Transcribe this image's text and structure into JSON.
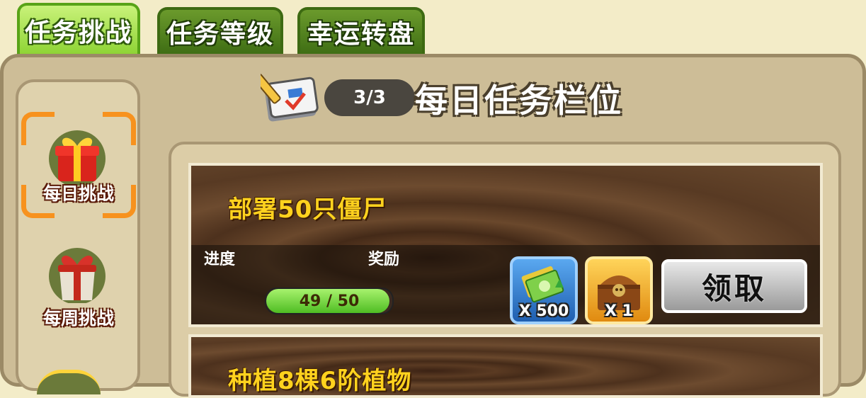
{
  "tabs": [
    {
      "label": "任务挑战",
      "active": true
    },
    {
      "label": "任务等级",
      "active": false
    },
    {
      "label": "幸运转盘",
      "active": false
    }
  ],
  "sidebar": {
    "items": [
      {
        "label": "每日挑战",
        "icon": "gift-box-icon",
        "selected": true
      },
      {
        "label": "每周挑战",
        "icon": "gift-bag-icon",
        "selected": false
      }
    ]
  },
  "header": {
    "icon": "notebook-pencil-icon",
    "counter": "3/3",
    "title": "每日任务栏位"
  },
  "tasks": [
    {
      "title": "部署50只僵尸",
      "progress_label": "进度",
      "reward_label": "奖励",
      "progress_text": "49 / 50",
      "progress_fraction": 0.98,
      "rewards": [
        {
          "icon": "cash-bills-icon",
          "qty": "X 500",
          "frame_color": "#2f7fd1"
        },
        {
          "icon": "treasure-chest-icon",
          "qty": "X 1",
          "frame_color": "#f0a020"
        }
      ],
      "claim_label": "领取"
    },
    {
      "title": "种植8棵6阶植物"
    }
  ],
  "colors": {
    "tab_active": "#8dd334",
    "tab_inactive": "#3f6e14",
    "task_title": "#ffd21e",
    "accent_orange": "#f7921e"
  }
}
